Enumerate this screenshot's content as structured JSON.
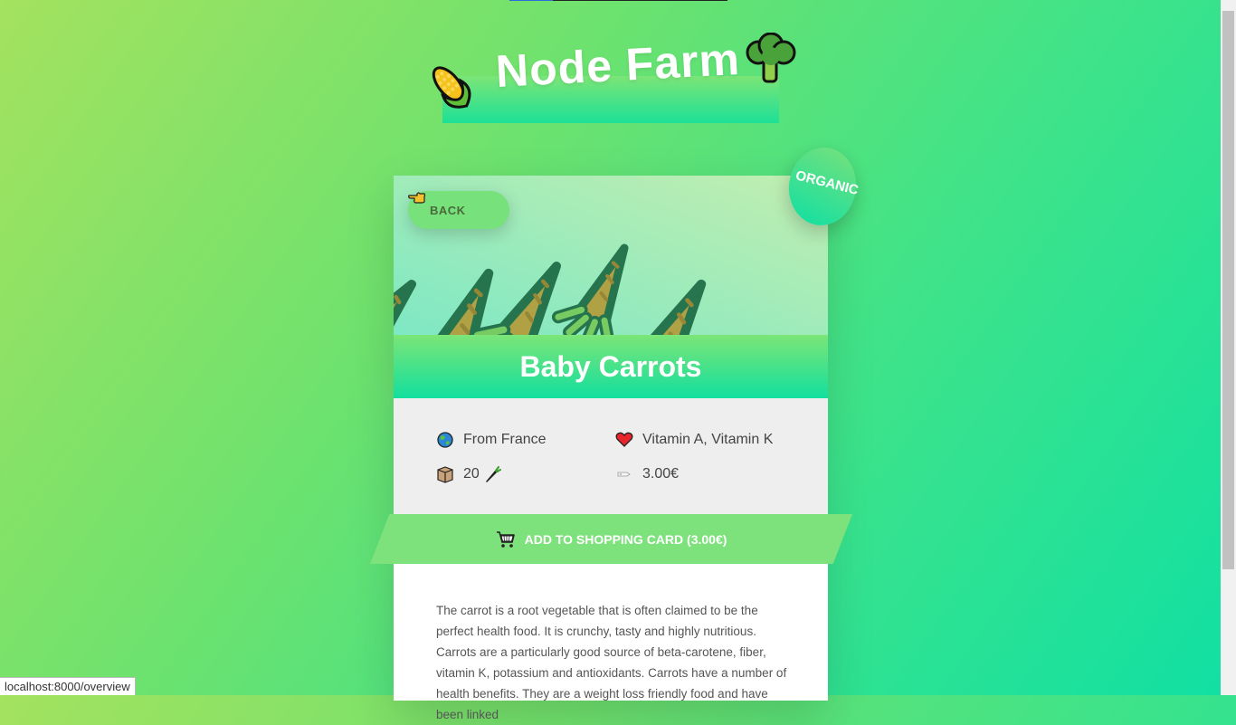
{
  "header": {
    "title": "Node Farm"
  },
  "product": {
    "name": "Baby Carrots",
    "organic_label": "ORGANIC",
    "back_label": "BACK",
    "from": "From France",
    "nutrients": "Vitamin A, Vitamin K",
    "quantity": "20",
    "price": "3.00€",
    "cart_label": "ADD TO SHOPPING CARD (3.00€)",
    "description": "The carrot is a root vegetable that is often claimed to be the perfect health food. It is crunchy, tasty and highly nutritious. Carrots are a particularly good source of beta-carotene, fiber, vitamin K, potassium and antioxidants. Carrots have a number of health benefits. They are a weight loss friendly food and have been linked"
  },
  "status_url": "localhost:8000/overview",
  "icons": {
    "corn": "corn-icon",
    "broccoli": "broccoli-icon",
    "hand": "pointing-hand-icon",
    "globe": "globe-icon",
    "heart": "heart-icon",
    "box": "box-icon",
    "carrot": "carrot-icon",
    "tag": "price-tag-icon",
    "cart": "shopping-cart-icon"
  },
  "colors": {
    "accent_green": "#7de27b",
    "accent_teal": "#12df9e",
    "card_bg": "#ffffff",
    "details_bg": "#eeeeee"
  }
}
